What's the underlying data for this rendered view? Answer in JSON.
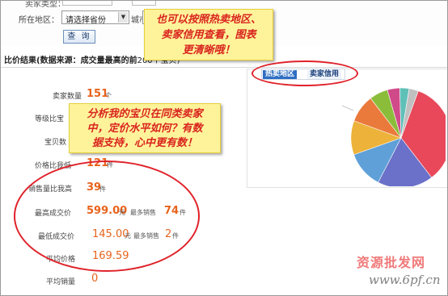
{
  "form": {
    "prev_label": "卖家类型：",
    "region_label": "所在地区：",
    "province_value": "请选择省份",
    "city_label": "城市：",
    "search_button": "查 询"
  },
  "result": {
    "title": "比价结果(数据来源：成交量最高的前",
    "title_suffix": "200个宝贝)"
  },
  "tabs": {
    "hot_region": "热卖地区",
    "seller_credit": "卖家信用"
  },
  "stats": {
    "seller_count_label": "卖家数量",
    "seller_count_value": "151",
    "seller_count_unit": "个",
    "same_label": "等级比宝",
    "baobei_label": "宝贝数",
    "price_lower_label": "价格比我低",
    "price_lower_value": "121",
    "price_lower_unit": "件",
    "sales_higher_label": "销售量比我高",
    "sales_higher_value": "39",
    "sales_higher_unit": "件",
    "max_price_label": "最高成交价",
    "max_price_value": "599.00",
    "max_price_unit": "元",
    "max_most_label": "最多销售",
    "max_most_value": "74",
    "max_most_unit": "件",
    "min_price_label": "最低成交价",
    "min_price_value": "145.00",
    "min_price_unit": "元",
    "min_most_label": "最多销售",
    "min_most_value": "2",
    "min_most_unit": "件",
    "avg_price_label": "平均价格",
    "avg_price_value": "169.59",
    "avg_sales_label": "平均销量",
    "avg_sales_value": "0"
  },
  "callouts": {
    "top_line1": "也可以按照热卖地区、",
    "top_line2": "卖家信用查看，图表",
    "top_line3": "更清晰哦！",
    "mid_line1": "分析我的宝贝在同类卖家",
    "mid_line2": "中，定价水平如何？有数",
    "mid_line3": "据支持，心中更有数！"
  },
  "watermark": {
    "title": "资源批发网",
    "url": "www.6pf.cn"
  },
  "colors": {
    "accent_orange": "#e8631c",
    "callout_text": "#d9241e",
    "callout_bg": "#fef39a",
    "annotation_red": "#e0222a",
    "tab_active": "#2f6fc3"
  },
  "chart_data": {
    "type": "pie",
    "title": "",
    "values": [
      34,
      18,
      12,
      11,
      9,
      6,
      4,
      3,
      3
    ],
    "colors": [
      "#e8485a",
      "#6b70c8",
      "#5fa0d8",
      "#ecb23a",
      "#ea7a3c",
      "#8bbd3a",
      "#d04a8a",
      "#5fc0b8",
      "#c0c0c0"
    ]
  }
}
